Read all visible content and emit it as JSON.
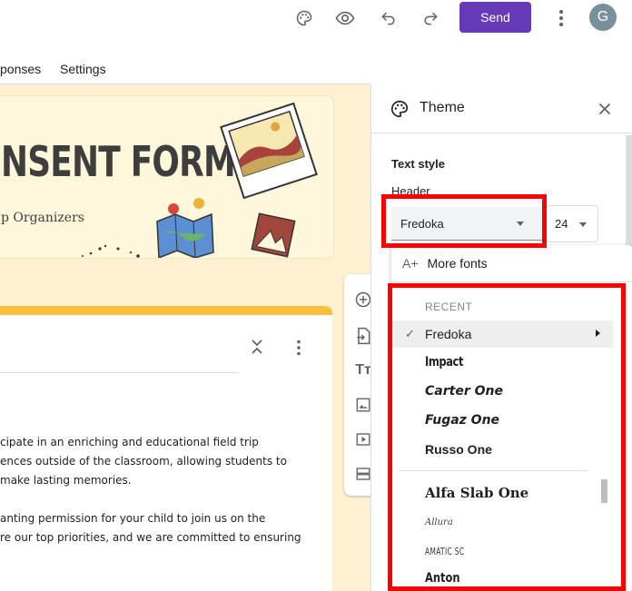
{
  "topbar": {
    "icons": [
      "palette-icon",
      "preview-eye-icon",
      "undo-icon",
      "redo-icon",
      "more-vert-icon"
    ],
    "send_label": "Send",
    "avatar_letter": "G"
  },
  "tabs": {
    "responses": "ponses",
    "settings": "Settings"
  },
  "form": {
    "title": "NSENT FORM",
    "subtitle": "p Organizers",
    "body_lines": [
      "cipate in an enriching and educational field trip",
      "ences outside of the classroom, allowing students to",
      "make lasting memories.",
      "anting permission for your child to join us on the",
      "re our top priorities, and we are committed to ensuring"
    ],
    "colors": {
      "background": "#fdf1d2",
      "accent": "#f9bf3c",
      "brand": "#673ab7"
    }
  },
  "side_toolbar": {
    "tools": [
      "add-question-icon",
      "import-questions-icon",
      "add-title-icon",
      "add-image-icon",
      "add-video-icon",
      "add-section-icon"
    ],
    "title_glyph": "Tт"
  },
  "theme_panel": {
    "title": "Theme",
    "text_style_label": "Text style",
    "header_label": "Header",
    "font_value": "Fredoka",
    "size_value": "24"
  },
  "font_menu": {
    "more_fonts_label": "More fonts",
    "more_fonts_glyph": "A+",
    "recent_label": "RECENT",
    "check_glyph": "✓",
    "recent_fonts": [
      "Fredoka",
      "Impact",
      "Carter One",
      "Fugaz One",
      "Russo One"
    ],
    "all_fonts": [
      "Alfa Slab One",
      "Allura",
      "Amatic SC",
      "Anton"
    ]
  }
}
